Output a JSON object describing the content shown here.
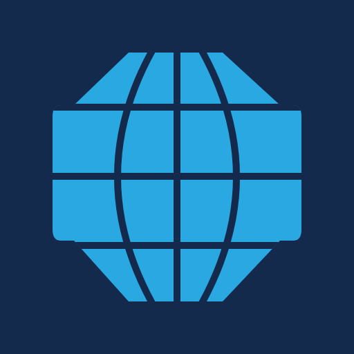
{
  "icon": {
    "name": "globe-icon",
    "background_color": "#142a4c",
    "glyph_color": "#29a8e2",
    "line_color": "#142a4c"
  }
}
